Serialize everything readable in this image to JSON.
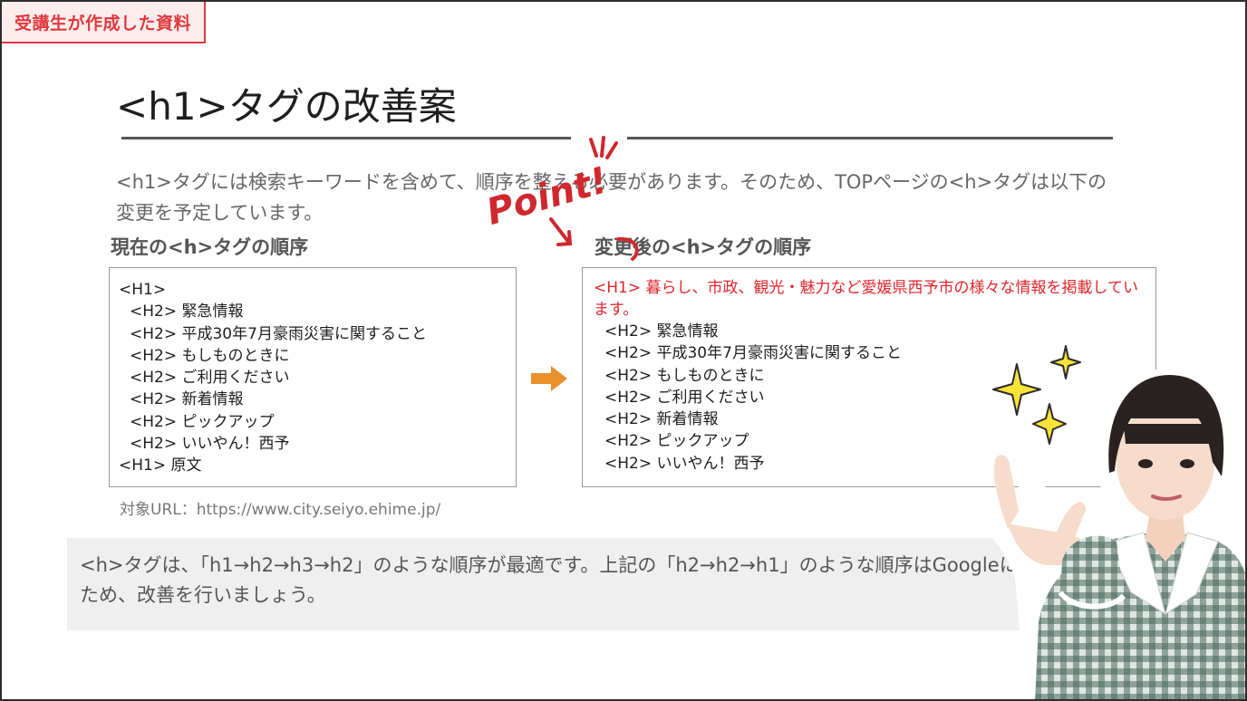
{
  "badge": "受講生が作成した資料",
  "title": "<h1>タグの改善案",
  "intro": "<h1>タグには検索キーワードを含めて、順序を整える必要があります。そのため、TOPページの<h>タグは以下の変更を予定しています。",
  "current": {
    "heading": "現在の<h>タグの順序",
    "lines": [
      "<H1>",
      "<H2> 緊急情報",
      "<H2> 平成30年7月豪雨災害に関すること",
      "<H2> もしものときに",
      "<H2> ご利用ください",
      "<H2> 新着情報",
      "<H2> ピックアップ",
      "<H2> いいやん！西予",
      "<H1> 原文"
    ]
  },
  "changed": {
    "heading": "変更後の<h>タグの順序",
    "highlight": "<H1> 暮らし、市政、観光・魅力など愛媛県西予市の様々な情報を掲載しています。",
    "lines": [
      "<H2> 緊急情報",
      "<H2> 平成30年7月豪雨災害に関すること",
      "<H2> もしものときに",
      "<H2> ご利用ください",
      "<H2> 新着情報",
      "<H2> ピックアップ",
      "<H2> いいやん！西予"
    ]
  },
  "source": "対象URL：https://www.city.seiyo.ehime.jp/",
  "note": "<h>タグは、「h1→h2→h3→h2」のような順序が最適です。上記の「h2→h2→h1」のような順序はGoogleに望ましくないため、改善を行いましょう。",
  "annotation": "Point!",
  "colors": {
    "accent": "#e0383e",
    "arrow": "#e8912c",
    "rule": "#555555"
  }
}
